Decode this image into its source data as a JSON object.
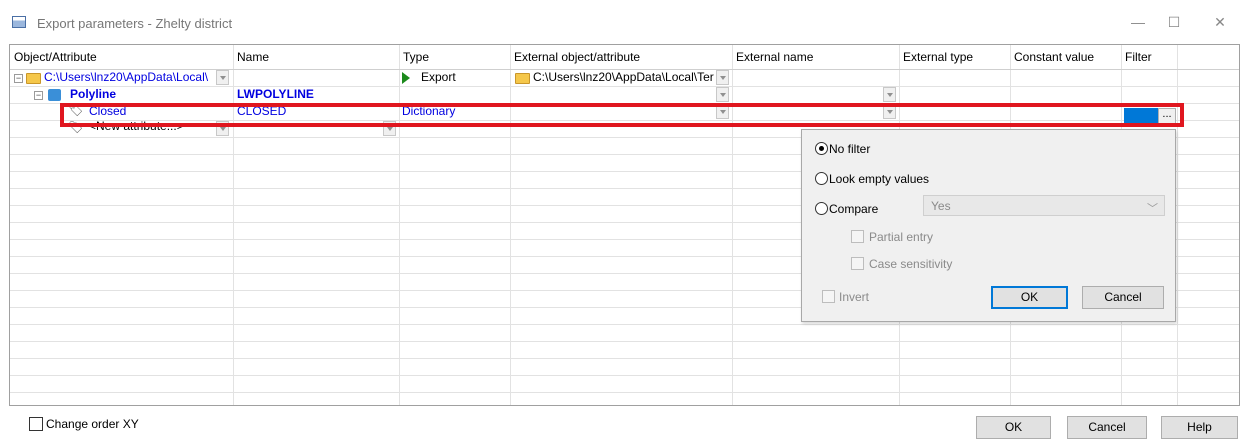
{
  "window": {
    "title": "Export parameters - Zhelty district",
    "minimize": "—",
    "maximize": "☐",
    "close": "✕"
  },
  "grid": {
    "headers": [
      "Object/Attribute",
      "Name",
      "Type",
      "External object/attribute",
      "External name",
      "External type",
      "Constant value",
      "Filter"
    ],
    "rows": {
      "root": {
        "toggle": "−",
        "object": "C:\\Users\\lnz20\\AppData\\Local\\",
        "type": "Export",
        "external_object": "C:\\Users\\lnz20\\AppData\\Local\\Ter"
      },
      "polyline": {
        "toggle": "−",
        "object": "Polyline",
        "name": "LWPOLYLINE"
      },
      "closed": {
        "object": "Closed",
        "name": "CLOSED",
        "type": "Dictionary",
        "filter_button": "..."
      },
      "new_attr": {
        "object": "<New attribute...>"
      }
    }
  },
  "filter_popup": {
    "no_filter": "No filter",
    "look_empty": "Look empty values",
    "compare": "Compare",
    "compare_value": "Yes",
    "partial_entry": "Partial entry",
    "case_sensitivity": "Case sensitivity",
    "invert": "Invert",
    "ok": "OK",
    "cancel": "Cancel",
    "selected": "no_filter"
  },
  "footer": {
    "change_order": "Change order XY",
    "ok": "OK",
    "cancel": "Cancel",
    "help": "Help"
  },
  "colors": {
    "highlight": "#e0161f",
    "link_blue": "#0000e0",
    "selection_blue": "#0078d7"
  }
}
